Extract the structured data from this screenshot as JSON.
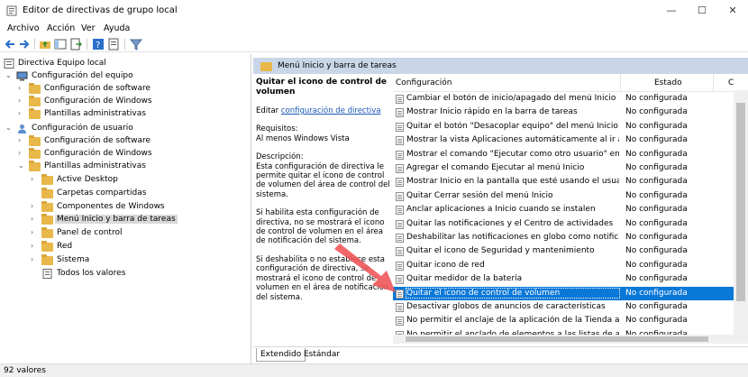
{
  "window": {
    "title": "Editor de directivas de grupo local",
    "minimize": "—",
    "maximize": "☐",
    "close": "✕"
  },
  "menu": [
    "Archivo",
    "Acción",
    "Ver",
    "Ayuda"
  ],
  "tree": [
    {
      "label": "Directiva Equipo local",
      "expand": ""
    },
    {
      "label": "Configuración del equipo",
      "expand": "⌄"
    },
    {
      "label": "Configuración de software",
      "expand": "›"
    },
    {
      "label": "Configuración de Windows",
      "expand": "›"
    },
    {
      "label": "Plantillas administrativas",
      "expand": "›"
    },
    {
      "label": "Configuración de usuario",
      "expand": "⌄"
    },
    {
      "label": "Configuración de software",
      "expand": "›"
    },
    {
      "label": "Configuración de Windows",
      "expand": "›"
    },
    {
      "label": "Plantillas administrativas",
      "expand": "⌄"
    },
    {
      "label": "Active Desktop",
      "expand": "›"
    },
    {
      "label": "Carpetas compartidas",
      "expand": ""
    },
    {
      "label": "Componentes de Windows",
      "expand": "›"
    },
    {
      "label": "Menú Inicio y barra de tareas",
      "expand": "›"
    },
    {
      "label": "Panel de control",
      "expand": "›"
    },
    {
      "label": "Red",
      "expand": "›"
    },
    {
      "label": "Sistema",
      "expand": "›"
    },
    {
      "label": "Todos los valores",
      "expand": ""
    }
  ],
  "section_title": "Menú Inicio y barra de tareas",
  "description": {
    "heading": "Quitar el icono de control de volumen",
    "edit_prefix": "Editar",
    "edit_link": "configuración de directiva",
    "requirements_label": "Requisitos:",
    "requirements_value": "Al menos Windows Vista",
    "description_label": "Descripción:",
    "p1": "Esta configuración de directiva le permite quitar el icono de control de volumen del área de control del sistema.",
    "p2": "Si habilita esta configuración de directiva, no se mostrará el icono de control de volumen en el área de notificación del sistema.",
    "p3": "Si deshabilita o no establece esta configuración de directiva, se mostrará el icono de control de volumen en el área de notificación del sistema."
  },
  "columns": {
    "setting": "Configuración",
    "state": "Estado",
    "extra": "C"
  },
  "settings": [
    {
      "name": "Cambiar el botón de inicio/apagado del menú Inicio",
      "state": "No configurada"
    },
    {
      "name": "Mostrar Inicio rápido en la barra de tareas",
      "state": "No configurada"
    },
    {
      "name": "Quitar el botón \"Desacoplar equipo\" del menú Inicio",
      "state": "No configurada"
    },
    {
      "name": "Mostrar la vista Aplicaciones automáticamente al ir a Inicio",
      "state": "No configurada"
    },
    {
      "name": "Mostrar el comando \"Ejecutar como otro usuario\" en Inicio",
      "state": "No configurada"
    },
    {
      "name": "Agregar el comando Ejecutar al menú Inicio",
      "state": "No configurada"
    },
    {
      "name": "Mostrar Inicio en la pantalla que esté usando el usuario al pre...",
      "state": "No configurada"
    },
    {
      "name": "Quitar Cerrar sesión del menú Inicio",
      "state": "No configurada"
    },
    {
      "name": "Anclar aplicaciones a Inicio cuando se instalen",
      "state": "No configurada"
    },
    {
      "name": "Quitar las notificaciones y el Centro de actividades",
      "state": "No configurada"
    },
    {
      "name": "Deshabilitar las notificaciones en globo como notificaciones...",
      "state": "No configurada"
    },
    {
      "name": "Quitar el icono de Seguridad y mantenimiento",
      "state": "No configurada"
    },
    {
      "name": "Quitar icono de red",
      "state": "No configurada"
    },
    {
      "name": "Quitar medidor de la batería",
      "state": "No configurada"
    },
    {
      "name": "Quitar el icono de control de volumen",
      "state": "No configurada"
    },
    {
      "name": "Desactivar globos de anuncios de características",
      "state": "No configurada"
    },
    {
      "name": "No permitir el anclaje de la aplicación de la Tienda a la barra...",
      "state": "No configurada"
    },
    {
      "name": "No permitir el anclado de elementos a las listas de accesos di...",
      "state": "No configurada"
    }
  ],
  "tabs": [
    "Extendido",
    "Estándar"
  ],
  "status": "92 valores",
  "colors": {
    "selection": "#0a78d7",
    "header_band": "#c8d6e8",
    "arrow": "#f0565a"
  }
}
